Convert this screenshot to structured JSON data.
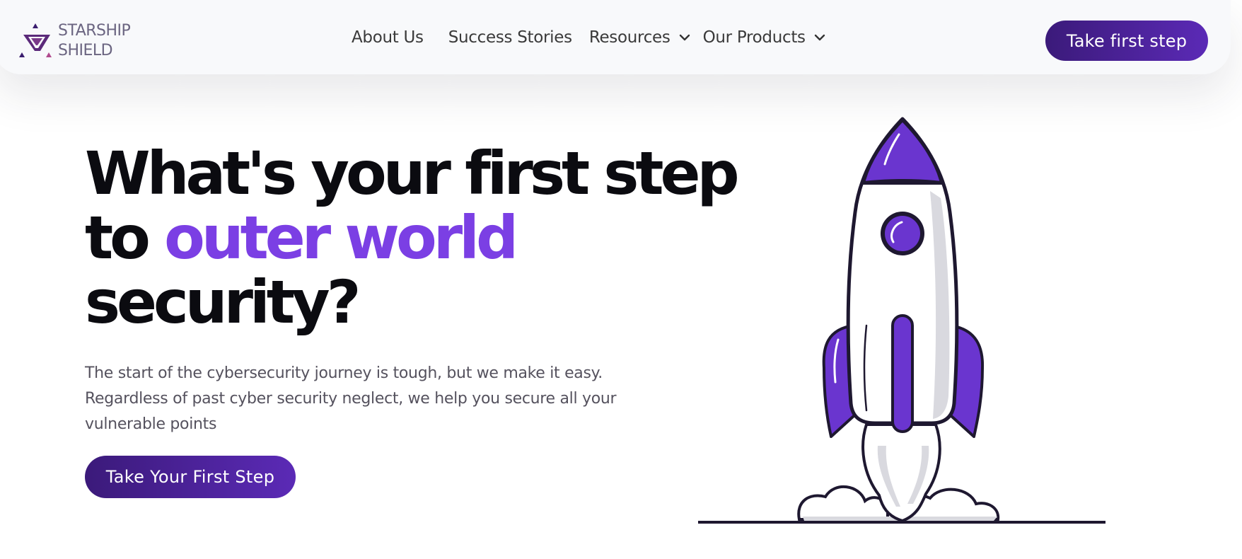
{
  "brand": {
    "name_line1": "STARSHIP",
    "name_line2": "SHIELD"
  },
  "nav": {
    "items": [
      {
        "label": "About Us",
        "has_dropdown": false
      },
      {
        "label": "Success Stories",
        "has_dropdown": false
      },
      {
        "label": "Resources",
        "has_dropdown": true
      },
      {
        "label": "Our Products",
        "has_dropdown": true
      }
    ],
    "cta_label": "Take first step"
  },
  "hero": {
    "headline_part1": "What's your first step",
    "headline_part2": "to",
    "headline_accent": "outer world",
    "headline_part3": "security?",
    "subtext": "The start of the cybersecurity journey is tough, but we make it easy. Regardless of past cyber security neglect, we help you secure all your vulnerable points",
    "cta_label": "Take Your First Step"
  },
  "colors": {
    "accent": "#7b3fe4",
    "button": "#4a2196",
    "logo_text": "#6b6581",
    "header_bg": "#f8f9fb"
  },
  "icons": {
    "logo": "starship-shield-logo-icon",
    "dropdown": "chevron-down-icon",
    "illustration": "rocket-illustration"
  }
}
